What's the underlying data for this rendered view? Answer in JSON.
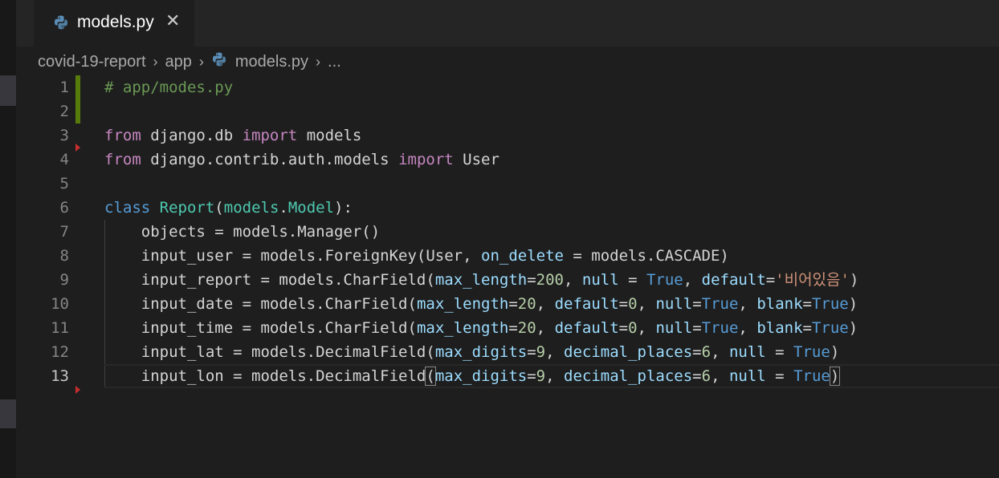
{
  "tab": {
    "label": "models.py",
    "close_glyph": "✕"
  },
  "breadcrumb": {
    "items": [
      "covid-19-report",
      "app",
      "models.py",
      "..."
    ],
    "separator": "›"
  },
  "editor": {
    "line_numbers": [
      "1",
      "2",
      "3",
      "4",
      "5",
      "6",
      "7",
      "8",
      "9",
      "10",
      "11",
      "12",
      "13"
    ],
    "active_line": "13",
    "lines": [
      [
        {
          "t": "# app/modes.py",
          "c": "cmt"
        }
      ],
      [],
      [
        {
          "t": "from",
          "c": "kw"
        },
        {
          "t": " django.db ",
          "c": ""
        },
        {
          "t": "import",
          "c": "kw"
        },
        {
          "t": " models",
          "c": ""
        }
      ],
      [
        {
          "t": "from",
          "c": "kw"
        },
        {
          "t": " django.contrib.auth.models ",
          "c": ""
        },
        {
          "t": "import",
          "c": "kw"
        },
        {
          "t": " User",
          "c": ""
        }
      ],
      [],
      [
        {
          "t": "class",
          "c": "def"
        },
        {
          "t": " ",
          "c": ""
        },
        {
          "t": "Report",
          "c": "cls"
        },
        {
          "t": "(",
          "c": ""
        },
        {
          "t": "models",
          "c": "cls"
        },
        {
          "t": ".",
          "c": ""
        },
        {
          "t": "Model",
          "c": "cls"
        },
        {
          "t": "):",
          "c": ""
        }
      ],
      [
        {
          "t": "    objects = models.Manager()",
          "c": ""
        }
      ],
      [
        {
          "t": "    input_user = models.ForeignKey(User, ",
          "c": ""
        },
        {
          "t": "on_delete",
          "c": "prm"
        },
        {
          "t": " = models.CASCADE)",
          "c": ""
        }
      ],
      [
        {
          "t": "    input_report = models.CharField(",
          "c": ""
        },
        {
          "t": "max_length",
          "c": "prm"
        },
        {
          "t": "=",
          "c": ""
        },
        {
          "t": "200",
          "c": "num"
        },
        {
          "t": ", ",
          "c": ""
        },
        {
          "t": "null",
          "c": "prm"
        },
        {
          "t": " = ",
          "c": ""
        },
        {
          "t": "True",
          "c": "con"
        },
        {
          "t": ", ",
          "c": ""
        },
        {
          "t": "default",
          "c": "prm"
        },
        {
          "t": "=",
          "c": ""
        },
        {
          "t": "'비어있음'",
          "c": "str"
        },
        {
          "t": ")",
          "c": ""
        }
      ],
      [
        {
          "t": "    input_date = models.CharField(",
          "c": ""
        },
        {
          "t": "max_length",
          "c": "prm"
        },
        {
          "t": "=",
          "c": ""
        },
        {
          "t": "20",
          "c": "num"
        },
        {
          "t": ", ",
          "c": ""
        },
        {
          "t": "default",
          "c": "prm"
        },
        {
          "t": "=",
          "c": ""
        },
        {
          "t": "0",
          "c": "num"
        },
        {
          "t": ", ",
          "c": ""
        },
        {
          "t": "null",
          "c": "prm"
        },
        {
          "t": "=",
          "c": ""
        },
        {
          "t": "True",
          "c": "con"
        },
        {
          "t": ", ",
          "c": ""
        },
        {
          "t": "blank",
          "c": "prm"
        },
        {
          "t": "=",
          "c": ""
        },
        {
          "t": "True",
          "c": "con"
        },
        {
          "t": ")",
          "c": ""
        }
      ],
      [
        {
          "t": "    input_time = models.CharField(",
          "c": ""
        },
        {
          "t": "max_length",
          "c": "prm"
        },
        {
          "t": "=",
          "c": ""
        },
        {
          "t": "20",
          "c": "num"
        },
        {
          "t": ", ",
          "c": ""
        },
        {
          "t": "default",
          "c": "prm"
        },
        {
          "t": "=",
          "c": ""
        },
        {
          "t": "0",
          "c": "num"
        },
        {
          "t": ", ",
          "c": ""
        },
        {
          "t": "null",
          "c": "prm"
        },
        {
          "t": "=",
          "c": ""
        },
        {
          "t": "True",
          "c": "con"
        },
        {
          "t": ", ",
          "c": ""
        },
        {
          "t": "blank",
          "c": "prm"
        },
        {
          "t": "=",
          "c": ""
        },
        {
          "t": "True",
          "c": "con"
        },
        {
          "t": ")",
          "c": ""
        }
      ],
      [
        {
          "t": "    input_lat = models.DecimalField(",
          "c": ""
        },
        {
          "t": "max_digits",
          "c": "prm"
        },
        {
          "t": "=",
          "c": ""
        },
        {
          "t": "9",
          "c": "num"
        },
        {
          "t": ", ",
          "c": ""
        },
        {
          "t": "decimal_places",
          "c": "prm"
        },
        {
          "t": "=",
          "c": ""
        },
        {
          "t": "6",
          "c": "num"
        },
        {
          "t": ", ",
          "c": ""
        },
        {
          "t": "null",
          "c": "prm"
        },
        {
          "t": " = ",
          "c": ""
        },
        {
          "t": "True",
          "c": "con"
        },
        {
          "t": ")",
          "c": ""
        }
      ],
      [
        {
          "t": "    input_lon = models.DecimalField",
          "c": ""
        },
        {
          "t": "(",
          "c": "",
          "hl": true
        },
        {
          "t": "max_digits",
          "c": "prm"
        },
        {
          "t": "=",
          "c": ""
        },
        {
          "t": "9",
          "c": "num"
        },
        {
          "t": ", ",
          "c": ""
        },
        {
          "t": "decimal_places",
          "c": "prm"
        },
        {
          "t": "=",
          "c": ""
        },
        {
          "t": "6",
          "c": "num"
        },
        {
          "t": ", ",
          "c": ""
        },
        {
          "t": "null",
          "c": "prm"
        },
        {
          "t": " = ",
          "c": ""
        },
        {
          "t": "True",
          "c": "con"
        },
        {
          "t": ")",
          "c": "",
          "hl": true
        }
      ]
    ]
  },
  "colors": {
    "background": "#1e1e1e",
    "tabbar": "#252526",
    "comment": "#6a9955",
    "keyword": "#c586c0",
    "storage": "#569cd6",
    "class": "#4ec9b0",
    "parameter": "#9cdcfe",
    "number": "#b5cea8",
    "string": "#ce9178",
    "gutter_added": "#587c0c"
  },
  "icons": {
    "tab_icon": "python-icon",
    "breadcrumb_file_icon": "python-icon",
    "close": "close-icon"
  }
}
